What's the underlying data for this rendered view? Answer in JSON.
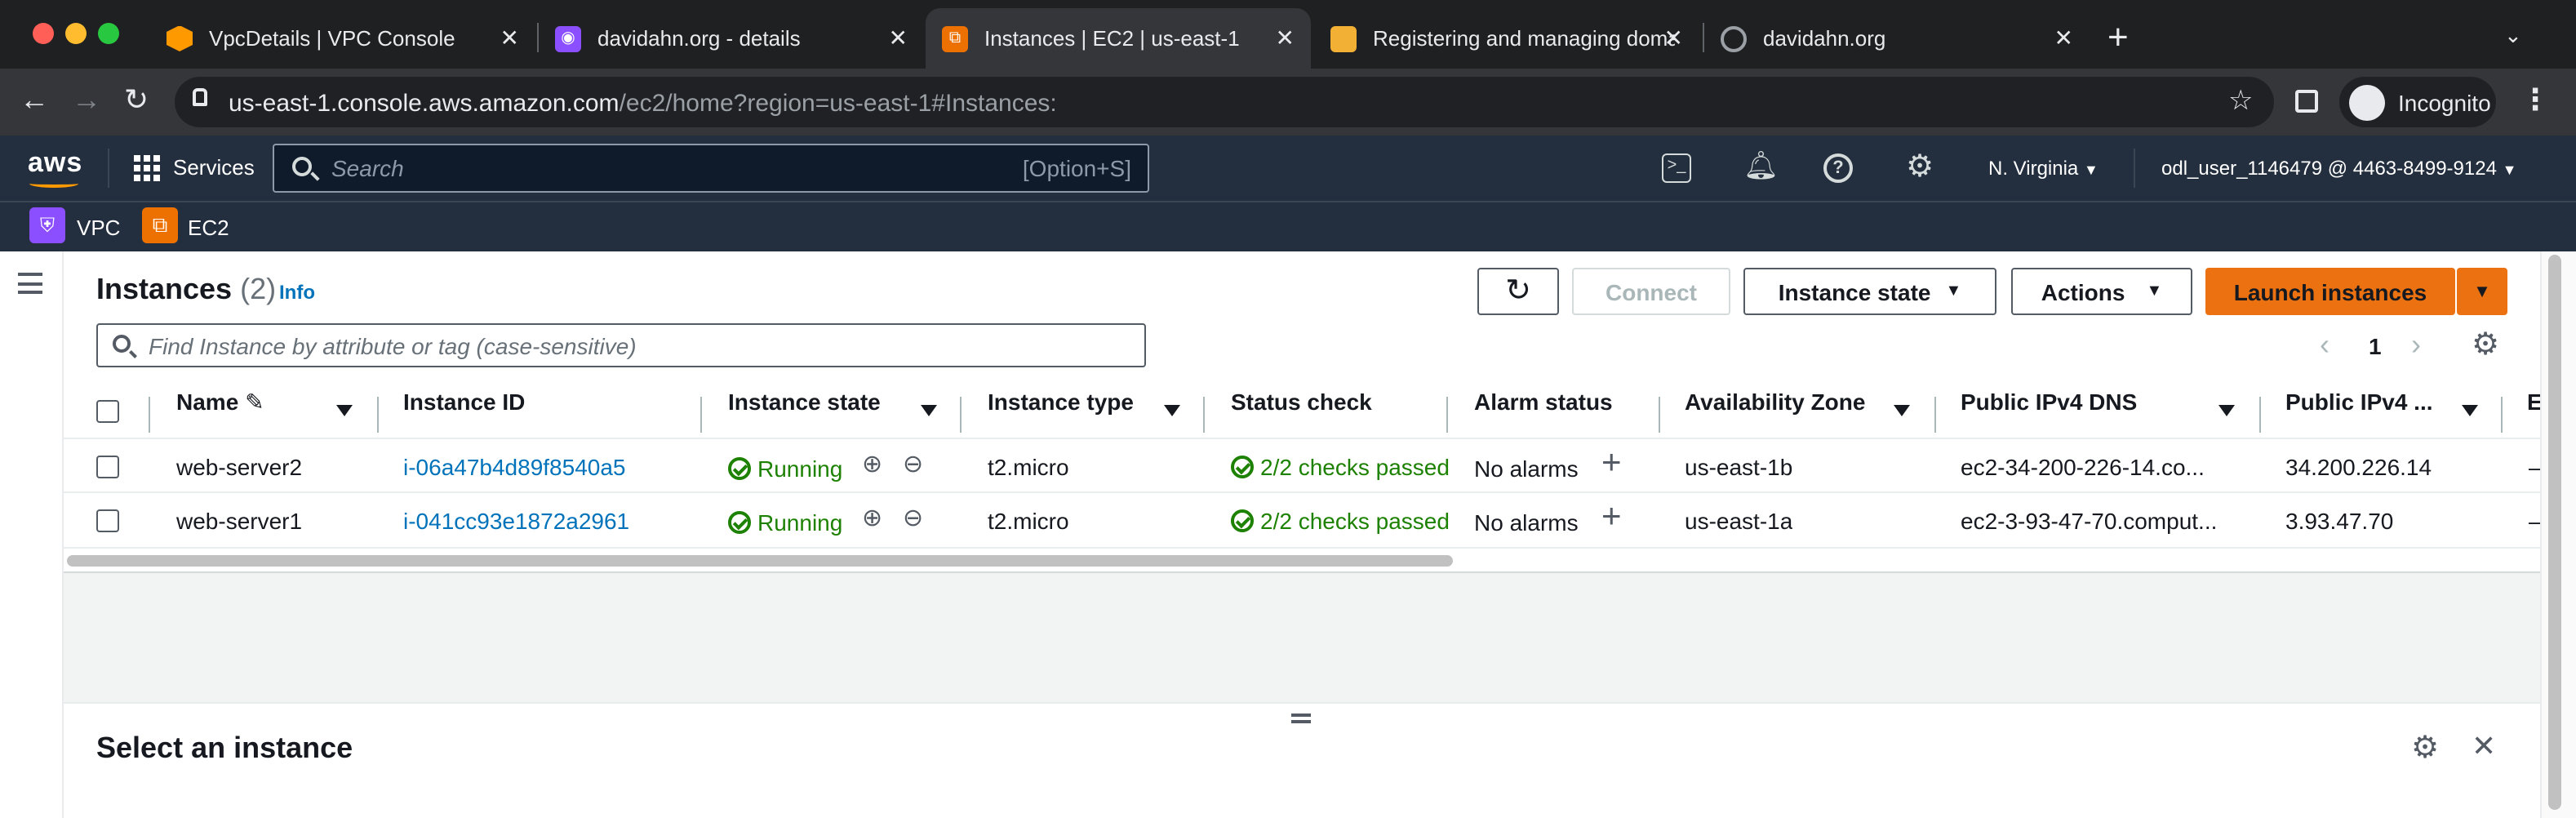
{
  "browser": {
    "tabs": [
      {
        "title": "VpcDetails | VPC Console",
        "favicon_color": "#ff9900"
      },
      {
        "title": "davidahn.org - details",
        "favicon_color": "#8c4fff"
      },
      {
        "title": "Instances | EC2 | us-east-1",
        "favicon_color": "#ed7100"
      },
      {
        "title": "Registering and managing domain",
        "favicon_color": "#f2b134"
      },
      {
        "title": "davidahn.org",
        "favicon_color": "#9aa0a6"
      }
    ],
    "url_host": "us-east-1.console.aws.amazon.com",
    "url_path": "/ec2/home?region=us-east-1#Instances:",
    "incognito_label": "Incognito"
  },
  "aws": {
    "logo": "aws",
    "services_label": "Services",
    "search_placeholder": "Search",
    "search_shortcut": "[Option+S]",
    "region": "N. Virginia",
    "account": "odl_user_1146479 @ 4463-8499-9124",
    "favorites": [
      {
        "label": "VPC",
        "color": "#8c4fff"
      },
      {
        "label": "EC2",
        "color": "#ed7100"
      }
    ]
  },
  "instances": {
    "title": "Instances",
    "count": "(2)",
    "info": "Info",
    "filter_placeholder": "Find Instance by attribute or tag (case-sensitive)",
    "page": "1",
    "buttons": {
      "connect": "Connect",
      "instance_state": "Instance state",
      "actions": "Actions",
      "launch": "Launch instances"
    },
    "columns": [
      "Name",
      "Instance ID",
      "Instance state",
      "Instance type",
      "Status check",
      "Alarm status",
      "Availability Zone",
      "Public IPv4 DNS",
      "Public IPv4 ...",
      "E"
    ],
    "rows": [
      {
        "name": "web-server2",
        "id": "i-06a47b4d89f8540a5",
        "state": "Running",
        "type": "t2.micro",
        "status": "2/2 checks passed",
        "alarm": "No alarms",
        "az": "us-east-1b",
        "dns": "ec2-34-200-226-14.co...",
        "ip": "34.200.226.14",
        "extra": "–"
      },
      {
        "name": "web-server1",
        "id": "i-041cc93e1872a2961",
        "state": "Running",
        "type": "t2.micro",
        "status": "2/2 checks passed",
        "alarm": "No alarms",
        "az": "us-east-1a",
        "dns": "ec2-3-93-47-70.comput...",
        "ip": "3.93.47.70",
        "extra": "–"
      }
    ]
  },
  "details_panel": {
    "title": "Select an instance"
  }
}
